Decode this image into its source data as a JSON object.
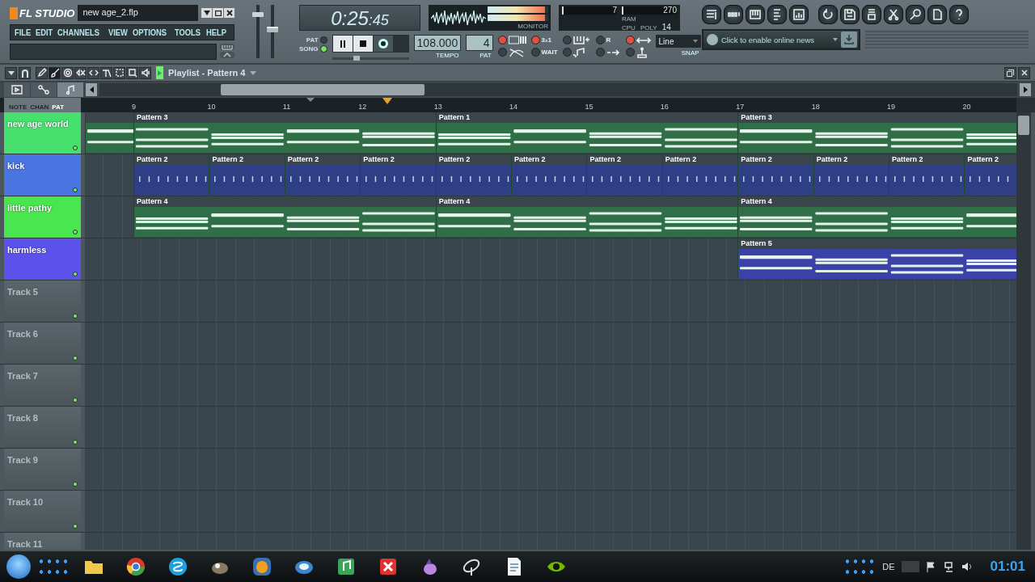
{
  "window": {
    "logo": "FL STUDIO",
    "filename": "new age_2.flp"
  },
  "menu": [
    {
      "label": "FILE"
    },
    {
      "label": "EDIT"
    },
    {
      "label": "CHANNELS"
    },
    {
      "label": "VIEW"
    },
    {
      "label": "OPTIONS"
    },
    {
      "label": "TOOLS"
    },
    {
      "label": "HELP"
    }
  ],
  "time_display": {
    "main": "0:25",
    "sub": ":45"
  },
  "meter": {
    "label": "MONITOR",
    "level": 0.95
  },
  "performance": {
    "value_1": "7",
    "value_2": "270",
    "ram_label": "RAM",
    "cpu_label": "CPU",
    "poly_label": "POLY",
    "poly": "14",
    "level": 0.03
  },
  "mode": [
    {
      "label": "PAT",
      "selected": false
    },
    {
      "label": "SONG",
      "selected": true
    }
  ],
  "tempo": {
    "value": "108.000",
    "label": "TEMPO"
  },
  "pattern": {
    "value": "4",
    "label": "PAT"
  },
  "sliders": [
    {
      "kind": "volume",
      "level": 0.85
    },
    {
      "kind": "pitch",
      "level": 0.55
    }
  ],
  "song_position": {
    "level": 0.3
  },
  "record_toggles": [
    {
      "kind": "typing",
      "on": true
    },
    {
      "label": "3₂1",
      "on": true
    },
    {
      "kind": "step",
      "on": false
    },
    {
      "label": "R",
      "on": false
    },
    {
      "kind": "blend",
      "on": true
    },
    {
      "kind": "metronome",
      "on": false
    },
    {
      "label": "WAIT",
      "on": false
    },
    {
      "kind": "note",
      "on": false
    },
    {
      "kind": "arrow",
      "on": false
    },
    {
      "kind": "joystick",
      "on": false
    }
  ],
  "snap": {
    "value": "Line",
    "label": "SNAP"
  },
  "toolbar_buttons": [
    {
      "kind": "playlist"
    },
    {
      "kind": "steps"
    },
    {
      "kind": "piano"
    },
    {
      "kind": "browser"
    },
    {
      "kind": "mixer"
    },
    {
      "kind": "undo"
    },
    {
      "kind": "save"
    },
    {
      "kind": "export"
    },
    {
      "kind": "cut"
    },
    {
      "kind": "record"
    },
    {
      "kind": "notes"
    },
    {
      "kind": "help"
    }
  ],
  "news": {
    "text": "Click to enable online news"
  },
  "playlist": {
    "title": "Playlist - Pattern 4",
    "tools": [
      {
        "kind": "pencil",
        "selected": false
      },
      {
        "kind": "brush",
        "selected": true
      },
      {
        "kind": "delete",
        "selected": false
      },
      {
        "kind": "mute",
        "selected": false
      },
      {
        "kind": "slip",
        "selected": false
      },
      {
        "kind": "slice",
        "selected": false
      },
      {
        "kind": "select",
        "selected": false
      },
      {
        "kind": "zoom",
        "selected": false
      },
      {
        "kind": "speaker",
        "selected": false
      }
    ],
    "view_tabs": [
      {
        "kind": "pattern",
        "selected": false
      },
      {
        "kind": "automation",
        "selected": false
      },
      {
        "kind": "audio",
        "selected": true
      }
    ],
    "filter": [
      {
        "label": "NOTE",
        "selected": false
      },
      {
        "label": "CHAN",
        "selected": false
      },
      {
        "label": "PAT",
        "selected": true
      }
    ],
    "ruler": [
      "9",
      "10",
      "11",
      "12",
      "13",
      "14",
      "15",
      "16",
      "17",
      "18",
      "19",
      "20"
    ],
    "tracks": [
      {
        "name": "new age world",
        "color": "#46e06e",
        "kind": "melody",
        "bars": [
          {
            "kind": "continue"
          },
          {
            "kind": "start",
            "label": "Pattern 3"
          },
          {
            "kind": "continue"
          },
          {
            "kind": "continue"
          },
          {
            "kind": "continue"
          },
          {
            "kind": "start",
            "label": "Pattern 1"
          },
          {
            "kind": "continue"
          },
          {
            "kind": "continue"
          },
          {
            "kind": "continue"
          },
          {
            "kind": "start",
            "label": "Pattern 3"
          },
          {
            "kind": "continue"
          },
          {
            "kind": "continue"
          },
          {
            "kind": "continue"
          }
        ]
      },
      {
        "name": "kick",
        "color": "#4a74e0",
        "kind": "drum",
        "bars": [
          {
            "kind": "empty"
          },
          {
            "kind": "start",
            "label": "Pattern 2"
          },
          {
            "kind": "start",
            "label": "Pattern 2"
          },
          {
            "kind": "start",
            "label": "Pattern 2"
          },
          {
            "kind": "start",
            "label": "Pattern 2"
          },
          {
            "kind": "start",
            "label": "Pattern 2"
          },
          {
            "kind": "start",
            "label": "Pattern 2"
          },
          {
            "kind": "start",
            "label": "Pattern 2"
          },
          {
            "kind": "start",
            "label": "Pattern 2"
          },
          {
            "kind": "start",
            "label": "Pattern 2"
          },
          {
            "kind": "start",
            "label": "Pattern 2"
          },
          {
            "kind": "start",
            "label": "Pattern 2"
          },
          {
            "kind": "start",
            "label": "Pattern 2"
          }
        ]
      },
      {
        "name": "little pathy",
        "color": "#4ae650",
        "kind": "melody",
        "bars": [
          {
            "kind": "empty"
          },
          {
            "kind": "start",
            "label": "Pattern 4"
          },
          {
            "kind": "continue"
          },
          {
            "kind": "continue"
          },
          {
            "kind": "continue"
          },
          {
            "kind": "start",
            "label": "Pattern 4"
          },
          {
            "kind": "continue"
          },
          {
            "kind": "continue"
          },
          {
            "kind": "continue"
          },
          {
            "kind": "start",
            "label": "Pattern 4"
          },
          {
            "kind": "continue"
          },
          {
            "kind": "continue"
          },
          {
            "kind": "continue"
          }
        ]
      },
      {
        "name": "harmless",
        "color": "#5a52ea",
        "kind": "lead",
        "bars": [
          {
            "kind": "empty"
          },
          {
            "kind": "empty"
          },
          {
            "kind": "empty"
          },
          {
            "kind": "empty"
          },
          {
            "kind": "empty"
          },
          {
            "kind": "empty"
          },
          {
            "kind": "empty"
          },
          {
            "kind": "empty"
          },
          {
            "kind": "empty"
          },
          {
            "kind": "start",
            "label": "Pattern 5"
          },
          {
            "kind": "continue"
          },
          {
            "kind": "continue"
          },
          {
            "kind": "continue"
          }
        ]
      },
      {
        "name": "Track 5"
      },
      {
        "name": "Track 6"
      },
      {
        "name": "Track 7"
      },
      {
        "name": "Track 8"
      },
      {
        "name": "Track 9"
      },
      {
        "name": "Track 10"
      },
      {
        "name": "Track 11"
      }
    ]
  },
  "taskbar": {
    "apps": [
      {
        "kind": "folder"
      },
      {
        "kind": "browser"
      },
      {
        "kind": "chat"
      },
      {
        "kind": "paint"
      },
      {
        "kind": "fruit"
      },
      {
        "kind": "cloud"
      },
      {
        "kind": "music"
      },
      {
        "kind": "cross"
      },
      {
        "kind": "pony"
      },
      {
        "kind": "dish"
      },
      {
        "kind": "document"
      },
      {
        "kind": "eye"
      }
    ],
    "language": "DE",
    "clock": "01:01"
  }
}
